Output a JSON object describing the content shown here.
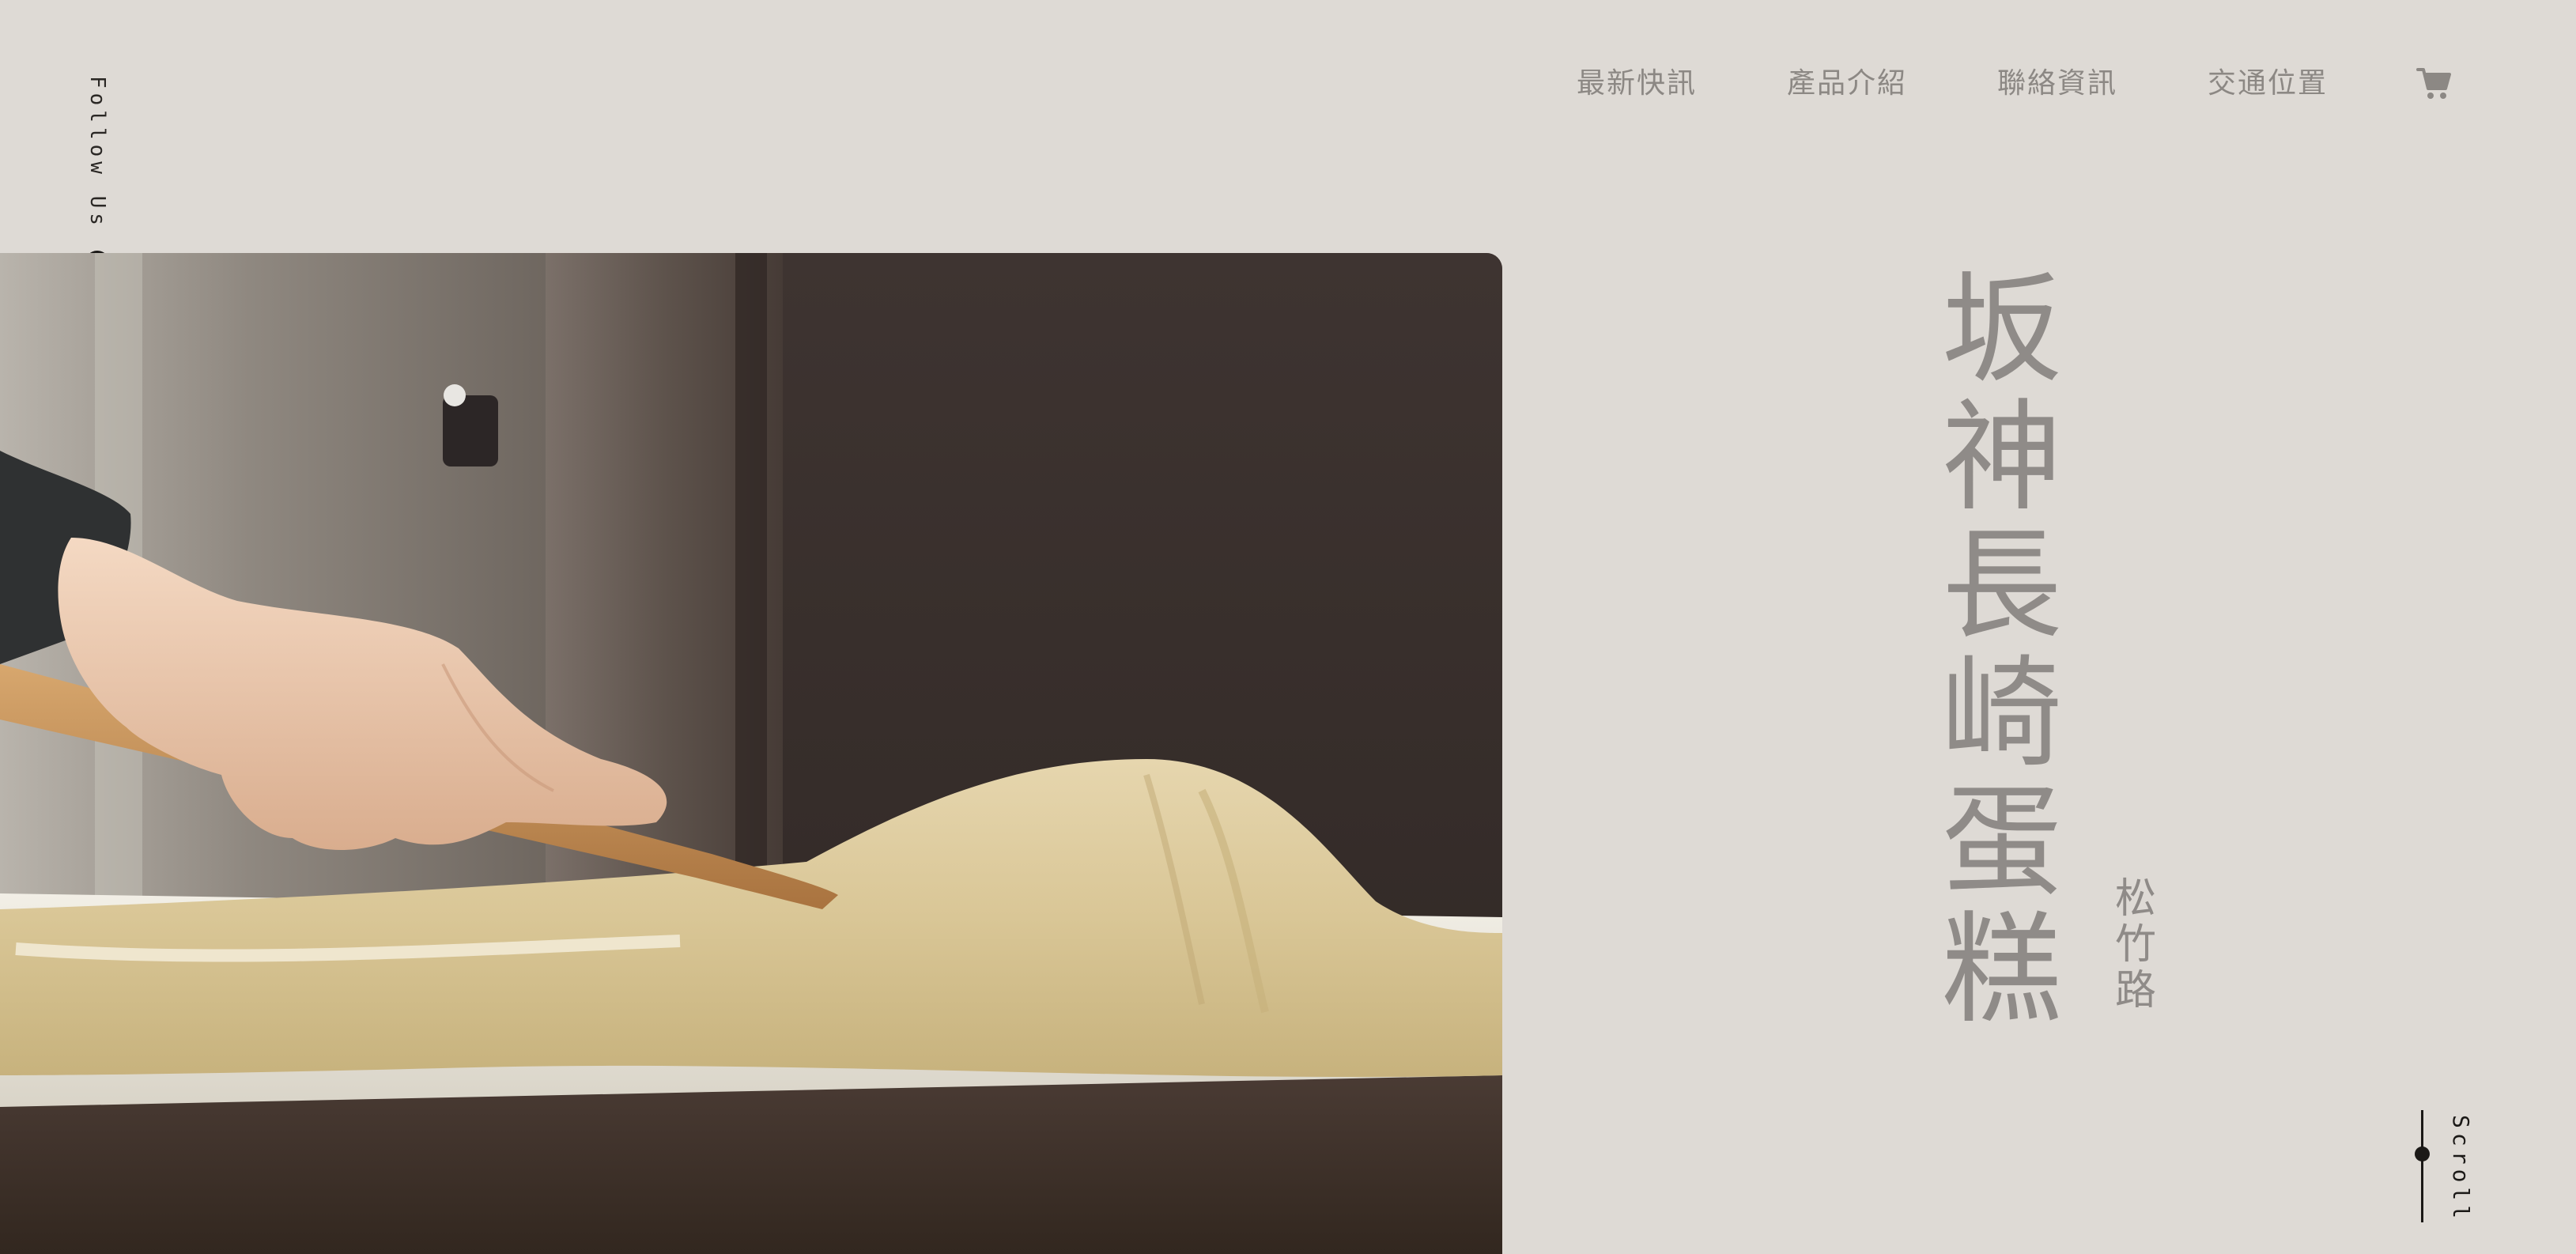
{
  "social": {
    "follow_label": "Follow Us",
    "icon": "facebook-icon"
  },
  "nav": {
    "items": [
      {
        "label": "最新快訊"
      },
      {
        "label": "產品介紹"
      },
      {
        "label": "聯絡資訊"
      },
      {
        "label": "交通位置"
      }
    ],
    "cart_icon": "cart-icon"
  },
  "hero": {
    "image": "hand-spreading-castella-batter-photo"
  },
  "title": {
    "chars": [
      "坂",
      "神",
      "長",
      "崎",
      "蛋",
      "糕"
    ],
    "sub_chars": [
      "松",
      "竹",
      "路"
    ]
  },
  "scroll": {
    "label": "Scroll"
  },
  "colors": {
    "background": "#dedad5",
    "nav_text": "#8c8884",
    "title_text": "#8f8b88",
    "accent_dark": "#1b1917"
  }
}
